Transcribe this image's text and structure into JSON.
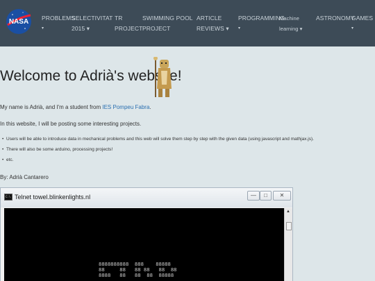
{
  "nav": {
    "logo_text": "NASA",
    "items": [
      {
        "line1": "PROBLEMS",
        "line2": "▾"
      },
      {
        "line1": "SELECTIVITAT",
        "line2": "2015 ▾"
      },
      {
        "line1": "TR",
        "line2": "PROJECT"
      },
      {
        "line1": "SWIMMING POOL",
        "line2": "PROJECT"
      },
      {
        "line1": "ARTICLE",
        "line2": "REVIEWS ▾"
      },
      {
        "line1": "PROGRAMMING",
        "line2": "▾"
      },
      {
        "line1": "Machine",
        "line2": "learning ▾"
      },
      {
        "line1": "ASTRONOMY",
        "line2": ""
      },
      {
        "line1": "GAMES",
        "line2": "▾"
      }
    ]
  },
  "main": {
    "title": "Welcome to Adrià's website!",
    "intro_before": "My name is Adrià, and I'm a student from ",
    "intro_link": "IES Pompeu Fabra",
    "intro_after": ".",
    "purpose": "In this website, I will be posting some interesting projects.",
    "bullets": [
      "Users will be able to introduce data in mechanical problems and this web will solve them step by step with the given data (using javascript and mathjax.js).",
      "There will also be some arduino, processing projects!",
      "etc."
    ],
    "byline": "By: Adrià Cantarero"
  },
  "telnet": {
    "title": "Telnet towel.blinkenlights.nl",
    "minimize": "—",
    "maximize": "□",
    "close": "✕",
    "ascii": "8888888888  888    88888\n88     88   88 88   88  88\n8888   88   88  88  88888"
  }
}
